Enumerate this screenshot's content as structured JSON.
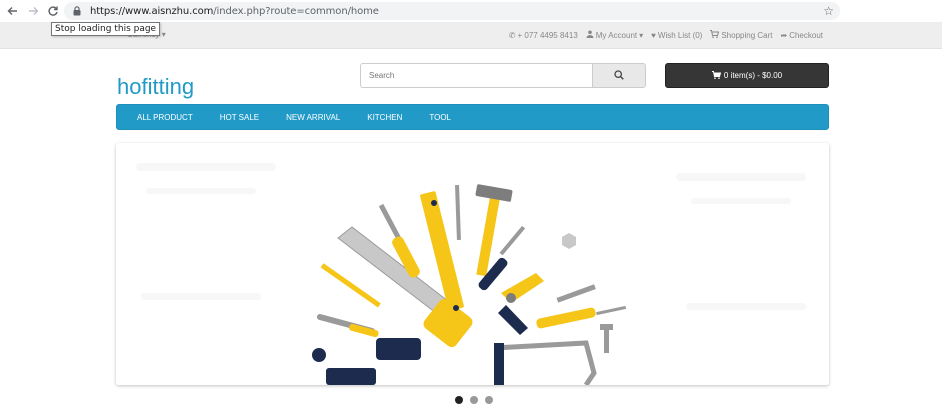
{
  "browser": {
    "url_host": "https://www.aisnzhu.com",
    "url_path": "/index.php?route=common/home",
    "tooltip": "Stop loading this page"
  },
  "top_bar": {
    "currency": "Currency",
    "phone": "+ 077 4495 8413",
    "my_account": "My Account",
    "wish_list": "Wish List (0)",
    "shopping_cart": "Shopping Cart",
    "checkout": "Checkout"
  },
  "header": {
    "logo": "hofitting",
    "search_placeholder": "Search",
    "cart_label": "0 item(s) - $0.00"
  },
  "menu": {
    "items": [
      "ALL PRODUCT",
      "HOT SALE",
      "NEW ARRIVAL",
      "KITCHEN",
      "TOOL"
    ]
  },
  "slideshow": {
    "slide_count": 3,
    "active_index": 0
  },
  "colors": {
    "accent": "#229ac8",
    "tool_yellow": "#f5c518",
    "tool_navy": "#1d2b4f"
  }
}
